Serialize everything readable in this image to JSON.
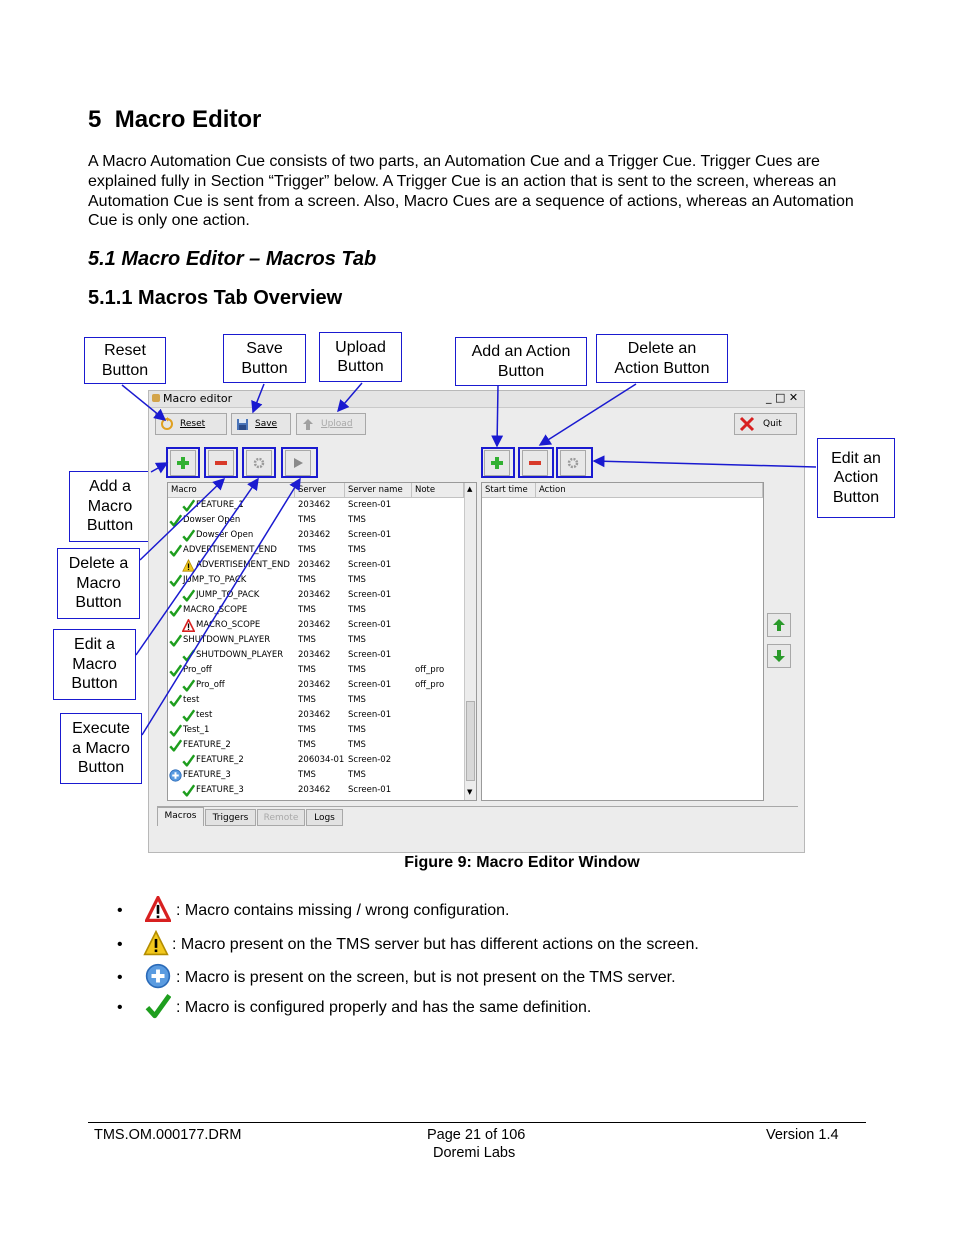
{
  "section": {
    "number": "5",
    "title": "Macro Editor"
  },
  "intro": "A Macro Automation Cue consists of two parts, an Automation Cue and a Trigger Cue. Trigger Cues are explained fully in Section “Trigger” below. A Trigger Cue is an action that is sent to the screen, whereas an Automation Cue is sent from a screen.  Also, Macro Cues are a sequence of actions, whereas an Automation Cue is only one action.",
  "subsection": "5.1 Macro Editor – Macros Tab",
  "subsubsection": "5.1.1 Macros Tab Overview",
  "callouts": {
    "reset": [
      "Reset",
      "Button"
    ],
    "save": [
      "Save",
      "Button"
    ],
    "upload": [
      "Upload",
      "Button"
    ],
    "add_action": [
      "Add an Action",
      "Button"
    ],
    "delete_action": [
      "Delete an",
      "Action Button"
    ],
    "edit_action": [
      "Edit an",
      "Action",
      "Button"
    ],
    "add_macro": [
      "Add a",
      "Macro",
      "Button"
    ],
    "delete_macro": [
      "Delete a",
      "Macro",
      "Button"
    ],
    "edit_macro": [
      "Edit a",
      "Macro",
      "Button"
    ],
    "execute_macro": [
      "Execute",
      "a Macro",
      "Button"
    ]
  },
  "window": {
    "title": "Macro editor",
    "title_controls": "_ □ ✕",
    "toolbar": {
      "reset": "Reset",
      "save": "Save",
      "upload": "Upload",
      "quit": "Quit"
    },
    "macro_columns": [
      "Macro",
      "Server",
      "Server name",
      "Note"
    ],
    "action_columns": [
      "Start time",
      "Action"
    ],
    "macros": [
      {
        "level": 1,
        "icon": "check",
        "name": "FEATURE_1",
        "server": "203462",
        "server_name": "Screen-01",
        "note": ""
      },
      {
        "level": 0,
        "icon": "check",
        "name": "Dowser Open",
        "server": "TMS",
        "server_name": "TMS",
        "note": ""
      },
      {
        "level": 1,
        "icon": "check",
        "name": "Dowser Open",
        "server": "203462",
        "server_name": "Screen-01",
        "note": ""
      },
      {
        "level": 0,
        "icon": "check",
        "name": "ADVERTISEMENT_END",
        "server": "TMS",
        "server_name": "TMS",
        "note": ""
      },
      {
        "level": 1,
        "icon": "warn",
        "name": "ADVERTISEMENT_END",
        "server": "203462",
        "server_name": "Screen-01",
        "note": ""
      },
      {
        "level": 0,
        "icon": "check",
        "name": "JUMP_TO_PACK",
        "server": "TMS",
        "server_name": "TMS",
        "note": ""
      },
      {
        "level": 1,
        "icon": "check",
        "name": "JUMP_TO_PACK",
        "server": "203462",
        "server_name": "Screen-01",
        "note": ""
      },
      {
        "level": 0,
        "icon": "check",
        "name": "MACRO_SCOPE",
        "server": "TMS",
        "server_name": "TMS",
        "note": ""
      },
      {
        "level": 1,
        "icon": "error",
        "name": "MACRO_SCOPE",
        "server": "203462",
        "server_name": "Screen-01",
        "note": ""
      },
      {
        "level": 0,
        "icon": "check",
        "name": "SHUTDOWN_PLAYER",
        "server": "TMS",
        "server_name": "TMS",
        "note": ""
      },
      {
        "level": 1,
        "icon": "check",
        "name": "SHUTDOWN_PLAYER",
        "server": "203462",
        "server_name": "Screen-01",
        "note": ""
      },
      {
        "level": 0,
        "icon": "check",
        "name": "Pro_off",
        "server": "TMS",
        "server_name": "TMS",
        "note": "off_pro"
      },
      {
        "level": 1,
        "icon": "check",
        "name": "Pro_off",
        "server": "203462",
        "server_name": "Screen-01",
        "note": "off_pro"
      },
      {
        "level": 0,
        "icon": "check",
        "name": "test",
        "server": "TMS",
        "server_name": "TMS",
        "note": ""
      },
      {
        "level": 1,
        "icon": "check",
        "name": "test",
        "server": "203462",
        "server_name": "Screen-01",
        "note": ""
      },
      {
        "level": 0,
        "icon": "check",
        "name": "Test_1",
        "server": "TMS",
        "server_name": "TMS",
        "note": ""
      },
      {
        "level": 0,
        "icon": "check",
        "name": "FEATURE_2",
        "server": "TMS",
        "server_name": "TMS",
        "note": ""
      },
      {
        "level": 1,
        "icon": "check",
        "name": "FEATURE_2",
        "server": "206034-01",
        "server_name": "Screen-02",
        "note": ""
      },
      {
        "level": 0,
        "icon": "plus",
        "name": "FEATURE_3",
        "server": "TMS",
        "server_name": "TMS",
        "note": ""
      },
      {
        "level": 1,
        "icon": "check",
        "name": "FEATURE_3",
        "server": "203462",
        "server_name": "Screen-01",
        "note": ""
      }
    ],
    "tabs": [
      "Macros",
      "Triggers",
      "Remote",
      "Logs"
    ]
  },
  "caption": "Figure 9: Macro Editor Window",
  "legend": [
    {
      "icon": "error",
      "text": ": Macro contains missing / wrong configuration."
    },
    {
      "icon": "warn",
      "text": ": Macro present on the TMS server but has different actions on the screen."
    },
    {
      "icon": "plus",
      "text": ": Macro is present on the screen, but is not present on the TMS server."
    },
    {
      "icon": "check",
      "text": ": Macro is configured properly and has the same definition."
    }
  ],
  "footer": {
    "doc_id": "TMS.OM.000177.DRM",
    "page": "Page 21 of 106",
    "company": "Doremi Labs",
    "version": "Version 1.4"
  },
  "colors": {
    "callout_blue": "#1a1ad0",
    "check_green": "#1e9e1e",
    "delete_red": "#d83a2a"
  }
}
